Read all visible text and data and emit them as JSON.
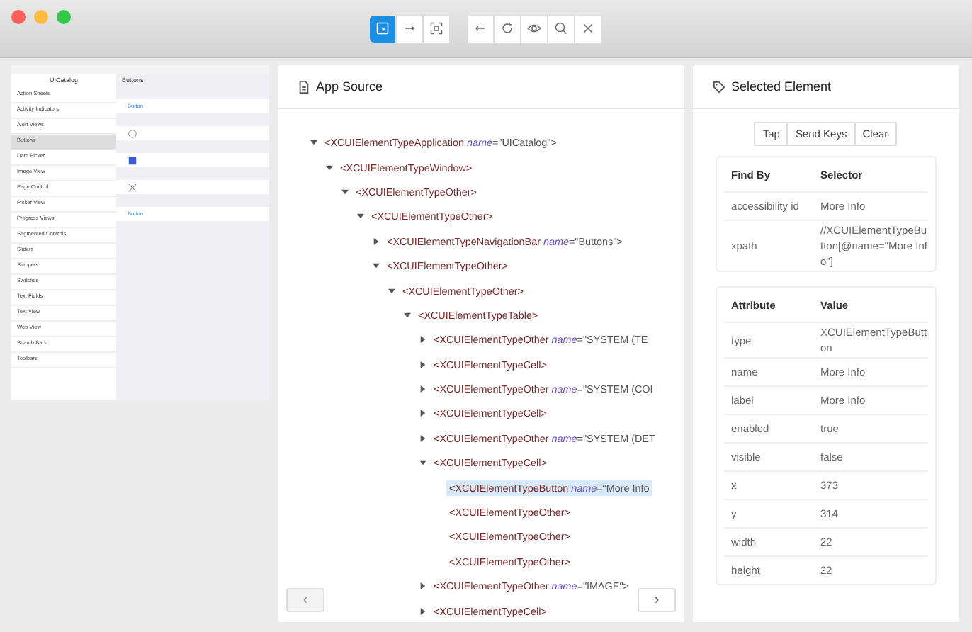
{
  "toolbar": {
    "groups": [
      [
        {
          "selected": true
        },
        {
          "selected": false
        },
        {
          "selected": false
        }
      ],
      [
        {
          "selected": false
        },
        {
          "selected": false
        },
        {
          "selected": false
        },
        {
          "selected": false
        },
        {
          "selected": false
        }
      ]
    ]
  },
  "device": {
    "master_title": "UICatalog",
    "detail_title": "Buttons",
    "items": [
      {
        "label": "Action Sheets",
        "selected": false
      },
      {
        "label": "Activity Indicators",
        "selected": false
      },
      {
        "label": "Alert Views",
        "selected": false
      },
      {
        "label": "Buttons",
        "selected": true
      },
      {
        "label": "Date Picker",
        "selected": false
      },
      {
        "label": "Image View",
        "selected": false
      },
      {
        "label": "Page Control",
        "selected": false
      },
      {
        "label": "Picker View",
        "selected": false
      },
      {
        "label": "Progress Views",
        "selected": false
      },
      {
        "label": "Segmented Controls",
        "selected": false
      },
      {
        "label": "Sliders",
        "selected": false
      },
      {
        "label": "Steppers",
        "selected": false
      },
      {
        "label": "Switches",
        "selected": false
      },
      {
        "label": "Text Fields",
        "selected": false
      },
      {
        "label": "Text View",
        "selected": false
      },
      {
        "label": "Web View",
        "selected": false
      },
      {
        "label": "Search Bars",
        "selected": false
      },
      {
        "label": "Toolbars",
        "selected": false
      }
    ],
    "cells": [
      {
        "kind": "text",
        "label": "Button"
      },
      {
        "kind": "info"
      },
      {
        "kind": "image"
      },
      {
        "kind": "x"
      },
      {
        "kind": "text",
        "label": "Button"
      }
    ]
  },
  "source": {
    "title": "App Source",
    "prev": "‹",
    "next": "›",
    "prev_disabled": true,
    "next_disabled": false,
    "tree": [
      {
        "kind": "branch",
        "expanded": true,
        "selected": false,
        "tag": "<XCUIElementTypeApplication",
        "attribute": "name",
        "value": "=\"UICatalog\">",
        "children": [
          {
            "kind": "branch",
            "expanded": true,
            "selected": false,
            "tag": "<XCUIElementTypeWindow>",
            "children": [
              {
                "kind": "branch",
                "expanded": true,
                "selected": false,
                "tag": "<XCUIElementTypeOther>",
                "children": [
                  {
                    "kind": "branch",
                    "expanded": true,
                    "selected": false,
                    "tag": "<XCUIElementTypeOther>",
                    "children": [
                      {
                        "kind": "branch",
                        "expanded": false,
                        "selected": false,
                        "tag": "<XCUIElementTypeNavigationBar",
                        "attribute": "name",
                        "value": "=\"Buttons\">"
                      },
                      {
                        "kind": "branch",
                        "expanded": true,
                        "selected": false,
                        "tag": "<XCUIElementTypeOther>",
                        "children": [
                          {
                            "kind": "branch",
                            "expanded": true,
                            "selected": false,
                            "tag": "<XCUIElementTypeOther>",
                            "children": [
                              {
                                "kind": "branch",
                                "expanded": true,
                                "selected": false,
                                "tag": "<XCUIElementTypeTable>",
                                "children": [
                                  {
                                    "kind": "branch",
                                    "expanded": false,
                                    "selected": false,
                                    "tag": "<XCUIElementTypeOther",
                                    "attribute": "name",
                                    "value": "=\"SYSTEM (TE"
                                  },
                                  {
                                    "kind": "branch",
                                    "expanded": false,
                                    "selected": false,
                                    "tag": "<XCUIElementTypeCell>"
                                  },
                                  {
                                    "kind": "branch",
                                    "expanded": false,
                                    "selected": false,
                                    "tag": "<XCUIElementTypeOther",
                                    "attribute": "name",
                                    "value": "=\"SYSTEM (COI"
                                  },
                                  {
                                    "kind": "branch",
                                    "expanded": false,
                                    "selected": false,
                                    "tag": "<XCUIElementTypeCell>"
                                  },
                                  {
                                    "kind": "branch",
                                    "expanded": false,
                                    "selected": false,
                                    "tag": "<XCUIElementTypeOther",
                                    "attribute": "name",
                                    "value": "=\"SYSTEM (DET"
                                  },
                                  {
                                    "kind": "branch",
                                    "expanded": true,
                                    "selected": false,
                                    "tag": "<XCUIElementTypeCell>",
                                    "children": [
                                      {
                                        "kind": "leaf",
                                        "selected": true,
                                        "tag": "<XCUIElementTypeButton",
                                        "attribute": "name",
                                        "value": "=\"More Info"
                                      },
                                      {
                                        "kind": "leaf",
                                        "selected": false,
                                        "tag": "<XCUIElementTypeOther>"
                                      },
                                      {
                                        "kind": "leaf",
                                        "selected": false,
                                        "tag": "<XCUIElementTypeOther>"
                                      },
                                      {
                                        "kind": "leaf",
                                        "selected": false,
                                        "tag": "<XCUIElementTypeOther>"
                                      }
                                    ]
                                  },
                                  {
                                    "kind": "branch",
                                    "expanded": false,
                                    "selected": false,
                                    "tag": "<XCUIElementTypeOther",
                                    "attribute": "name",
                                    "value": "=\"IMAGE\">"
                                  },
                                  {
                                    "kind": "branch",
                                    "expanded": false,
                                    "selected": false,
                                    "tag": "<XCUIElementTypeCell>"
                                  }
                                ]
                              }
                            ]
                          }
                        ]
                      }
                    ]
                  }
                ]
              }
            ]
          }
        ]
      }
    ]
  },
  "selected": {
    "title": "Selected Element",
    "actions": [
      "Tap",
      "Send Keys",
      "Clear"
    ],
    "selectors": {
      "columns": [
        "Find By",
        "Selector"
      ],
      "rows": [
        [
          "accessibility id",
          "More Info"
        ],
        [
          "xpath",
          "//XCUIElementTypeButton[@name=\"More Info\"]"
        ]
      ]
    },
    "attributes": {
      "columns": [
        "Attribute",
        "Value"
      ],
      "rows": [
        [
          "type",
          "XCUIElementTypeButton"
        ],
        [
          "name",
          "More Info"
        ],
        [
          "label",
          "More Info"
        ],
        [
          "enabled",
          "true"
        ],
        [
          "visible",
          "false"
        ],
        [
          "x",
          "373"
        ],
        [
          "y",
          "314"
        ],
        [
          "width",
          "22"
        ],
        [
          "height",
          "22"
        ]
      ]
    }
  }
}
